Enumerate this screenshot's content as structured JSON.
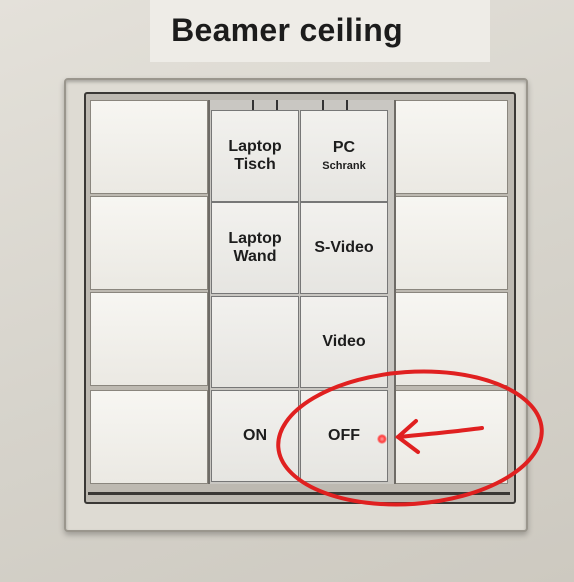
{
  "header": {
    "title": "Beamer ceiling"
  },
  "panel": {
    "rows": [
      {
        "left": {
          "line1": "Laptop",
          "line2": "Tisch"
        },
        "right": {
          "line1": "PC",
          "line2": "Schrank"
        }
      },
      {
        "left": {
          "line1": "Laptop",
          "line2": "Wand"
        },
        "right": {
          "line1": "S-Video",
          "line2": ""
        }
      },
      {
        "left": {
          "line1": "",
          "line2": ""
        },
        "right": {
          "line1": "Video",
          "line2": ""
        }
      },
      {
        "left": {
          "line1": "ON",
          "line2": ""
        },
        "right": {
          "line1": "OFF",
          "line2": ""
        }
      }
    ]
  },
  "annotation": {
    "color": "#e02020",
    "led_color": "#ff3b3b"
  }
}
